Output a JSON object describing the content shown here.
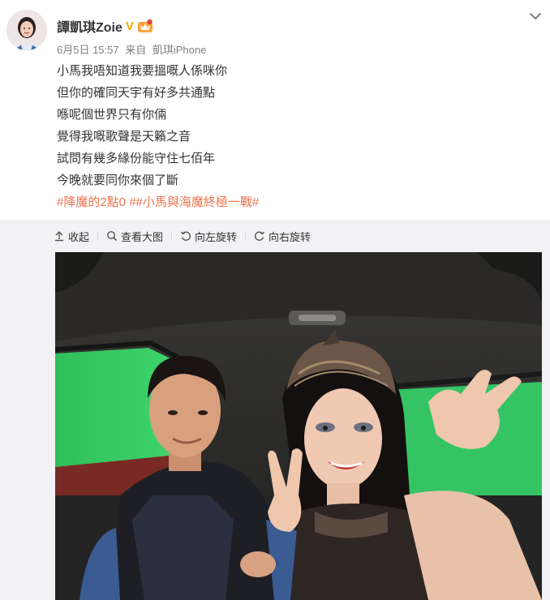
{
  "post": {
    "user_name": "譚凱琪Zoie",
    "verified_mark": "V",
    "date": "6月5日 15:57",
    "source_prefix": "来自",
    "source_device": "凱琪iPhone",
    "lines": [
      "小馬我唔知道我要搵嘅人係咪你",
      "但你的確同天宇有好多共通點",
      "喺呢個世界只有你倆",
      "覺得我嘅歌聲是天籟之音",
      "試問有幾多緣份能守住七佰年",
      "今晚就要同你來個了斷"
    ],
    "hashtags": [
      "#降魔的2點0 #",
      "#小馬與海魔終極一戰#"
    ]
  },
  "toolbar": {
    "collapse_label": "收起",
    "view_large_label": "查看大图",
    "rotate_left_label": "向左旋转",
    "rotate_right_label": "向右旋转"
  },
  "icons": {
    "collapse": "arrow-up-icon",
    "view_large": "magnifier-icon",
    "rotate_left": "rotate-left-icon",
    "rotate_right": "rotate-right-icon",
    "menu": "chevron-down-icon",
    "verified": "verified-v-icon",
    "member": "member-crown-icon"
  },
  "colors": {
    "hashtag": "#eb7350",
    "meta_text": "#808080",
    "verified": "#f2a600",
    "media_bg": "#f2f2f5"
  }
}
